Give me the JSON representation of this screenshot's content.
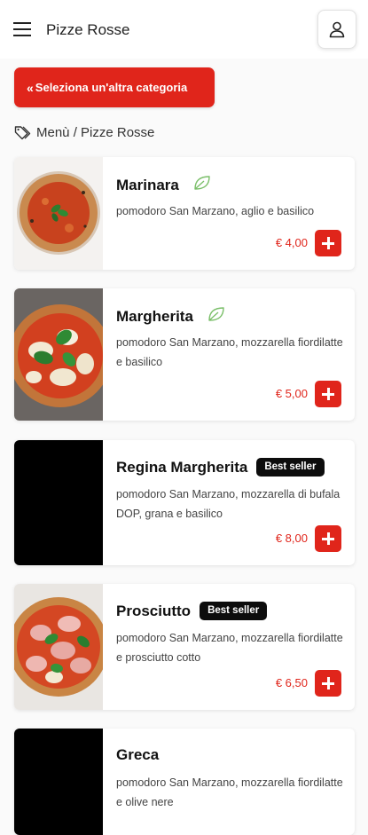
{
  "header": {
    "brand": "Pizze Rosse",
    "menu_icon": "hamburger-icon",
    "account_icon": "user-icon"
  },
  "category_button": {
    "label": "Seleziona un'altra categoria",
    "icon": "double-chevron-left-icon"
  },
  "breadcrumb": {
    "icon": "tags-icon",
    "text": "Menù / Pizze Rosse"
  },
  "colors": {
    "accent": "#e0251b",
    "veg": "#7bbf6a",
    "badge": "#0d0d0d"
  },
  "items": [
    {
      "name": "Marinara",
      "vegetarian": true,
      "badge": "",
      "description": "pomodoro San Marzano, aglio e basilico",
      "price": "€ 4,00",
      "image": "pizza-marinara"
    },
    {
      "name": "Margherita",
      "vegetarian": true,
      "badge": "",
      "description": "pomodoro San Marzano, mozzarella fiordilatte e basilico",
      "price": "€ 5,00",
      "image": "pizza-margherita"
    },
    {
      "name": "Regina Margherita",
      "vegetarian": false,
      "badge": "Best seller",
      "description": "pomodoro San Marzano, mozzarella di bufala DOP, grana e basilico",
      "price": "€ 8,00",
      "image": "black-placeholder"
    },
    {
      "name": "Prosciutto",
      "vegetarian": false,
      "badge": "Best seller",
      "description": "pomodoro San Marzano, mozzarella fiordilatte e prosciutto cotto",
      "price": "€ 6,50",
      "image": "pizza-prosciutto"
    },
    {
      "name": "Greca",
      "vegetarian": false,
      "badge": "",
      "description": "pomodoro San Marzano, mozzarella fiordilatte e olive nere",
      "price": "",
      "image": "black-placeholder"
    }
  ]
}
